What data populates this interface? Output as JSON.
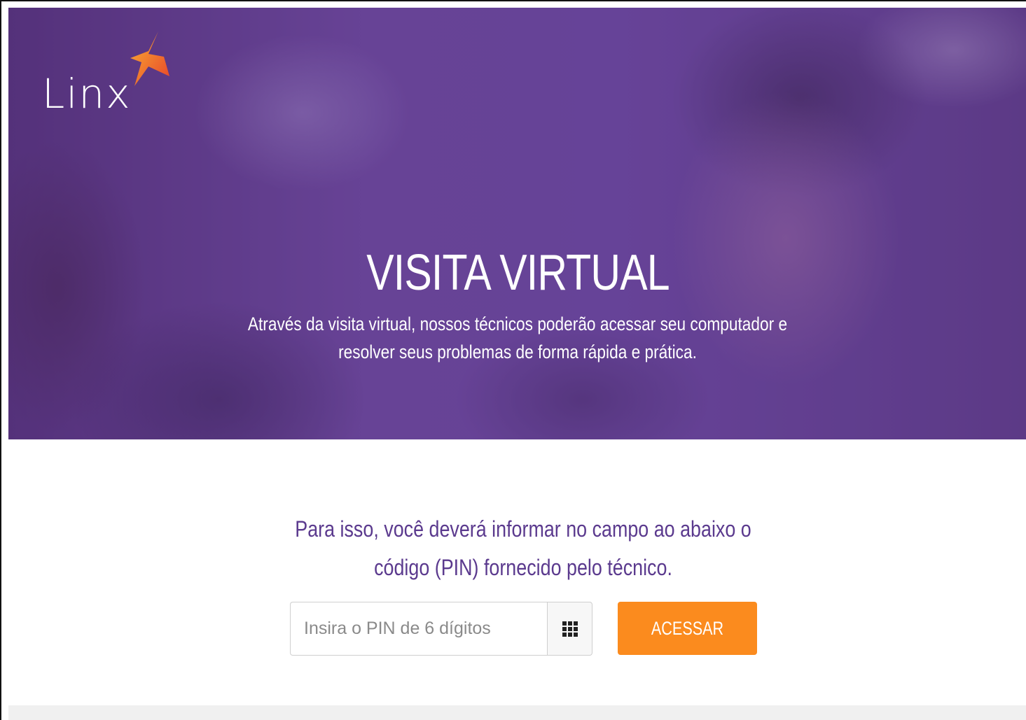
{
  "brand": {
    "logo_text": "Linx",
    "accent_color": "#fb8b1e",
    "primary_color": "#5b3a8e"
  },
  "hero": {
    "title": "VISITA VIRTUAL",
    "description": "Através da visita virtual, nossos técnicos poderão acessar seu computador e resolver seus problemas de forma rápida e prática."
  },
  "form": {
    "instruction": "Para isso, você deverá informar no campo ao abaixo o código (PIN) fornecido pelo técnico.",
    "pin_placeholder": "Insira o PIN de 6 dígitos",
    "pin_value": "",
    "keypad_icon": "keypad-grid-icon",
    "submit_label": "ACESSAR"
  }
}
